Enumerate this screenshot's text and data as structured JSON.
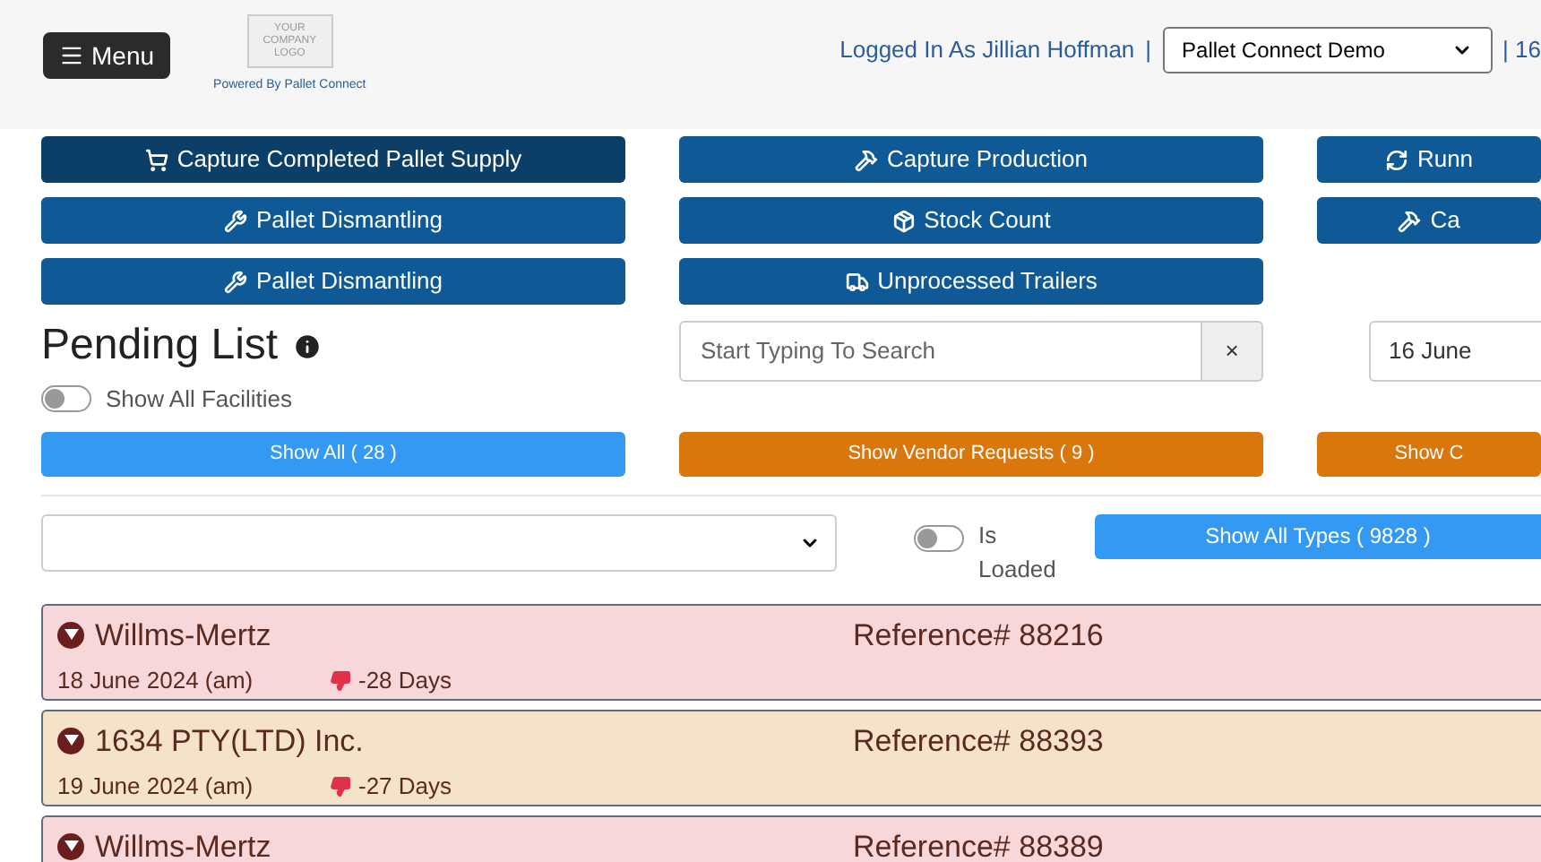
{
  "header": {
    "menu_label": "Menu",
    "logo_text": "YOUR COMPANY LOGO",
    "powered_by": "Powered By Pallet Connect",
    "logged_in": "Logged In As Jillian Hoffman",
    "separator": "|",
    "company_select": "Pallet Connect Demo",
    "date_cut": "| 16"
  },
  "actions": [
    {
      "label": "Capture Completed Pallet Supply",
      "kind": "supply",
      "hovered": true
    },
    {
      "label": "Capture Production",
      "kind": "production",
      "hovered": false
    },
    {
      "label": "Runn",
      "kind": "cycle",
      "hovered": false
    },
    {
      "label": "Pallet Dismantling",
      "kind": "dismantling",
      "hovered": false
    },
    {
      "label": "Stock Count",
      "kind": "stock",
      "hovered": false
    },
    {
      "label": "Ca",
      "kind": "production",
      "hovered": false
    },
    {
      "label": "Pallet Dismantling",
      "kind": "dismantling",
      "hovered": false
    },
    {
      "label": "Unprocessed Trailers",
      "kind": "trailers",
      "hovered": false
    }
  ],
  "pending": {
    "title": "Pending List",
    "show_all_facilities": {
      "label": "Show All Facilities",
      "on": false
    },
    "search": {
      "placeholder": "Start Typing To Search",
      "clear": "×"
    },
    "date": "16 June"
  },
  "filters": [
    {
      "label": "Show All ( 28 )",
      "color": "#3399f3"
    },
    {
      "label": "Show Vendor Requests ( 9 )",
      "color": "#d9770c"
    },
    {
      "label": "Show C",
      "color": "#d9770c"
    }
  ],
  "is_loaded": {
    "label": "Is Loaded",
    "on": false
  },
  "show_all_types": "Show All Types ( 9828 )",
  "rows": [
    {
      "name": "Willms-Mertz",
      "reference": "Reference# 88216",
      "date": "18 June 2024 (am)",
      "days": "-28 Days",
      "color": "#f8d7da"
    },
    {
      "name": "1634 PTY(LTD) Inc.",
      "reference": "Reference# 88393",
      "date": "19 June 2024 (am)",
      "days": "-27 Days",
      "color": "#f5e3c9"
    },
    {
      "name": "Willms-Mertz",
      "reference": "Reference# 88389",
      "color": "#f8d7da"
    }
  ]
}
